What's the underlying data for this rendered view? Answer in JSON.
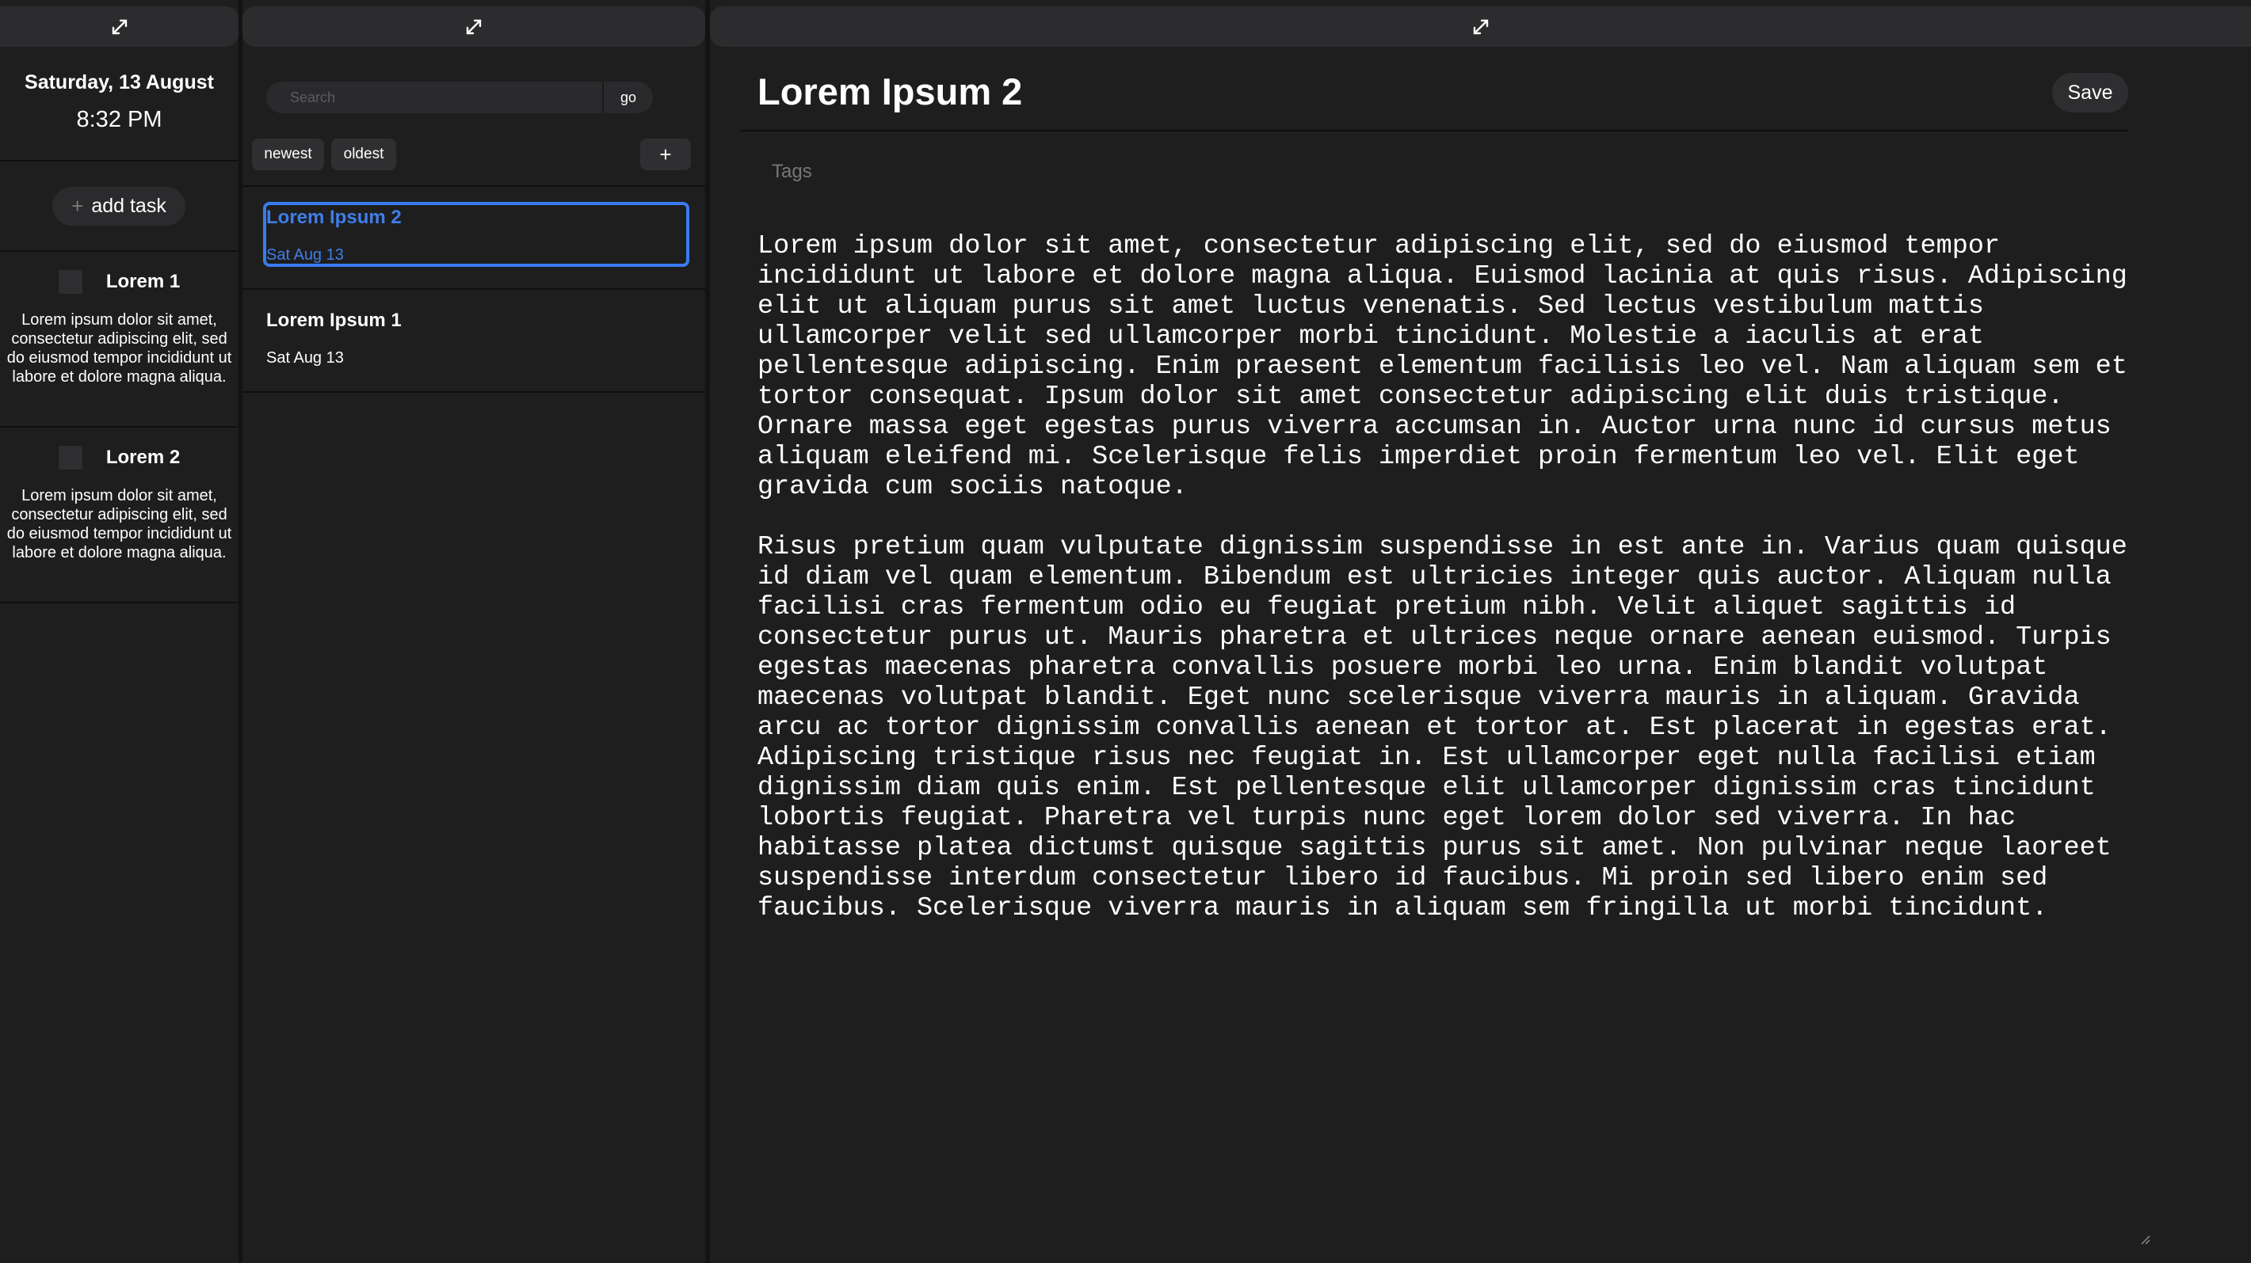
{
  "left_panel": {
    "expand_icon": "expand-diagonal-icon",
    "date": "Saturday, 13 August",
    "time": "8:32 PM",
    "add_task_label": "add task",
    "add_task_icon": "plus-icon",
    "tasks": [
      {
        "title": "Lorem 1",
        "checked": false,
        "description": "Lorem ipsum dolor sit amet, consectetur adipiscing elit, sed do eiusmod tempor incididunt ut labore et dolore magna aliqua."
      },
      {
        "title": "Lorem 2",
        "checked": false,
        "description": "Lorem ipsum dolor sit amet, consectetur adipiscing elit, sed do eiusmod tempor incididunt ut labore et dolore magna aliqua."
      }
    ]
  },
  "middle_panel": {
    "expand_icon": "expand-diagonal-icon",
    "search": {
      "placeholder": "Search",
      "value": "",
      "go_label": "go"
    },
    "sort": {
      "newest_label": "newest",
      "oldest_label": "oldest"
    },
    "new_note_label": "+",
    "notes": [
      {
        "title": "Lorem Ipsum 2",
        "date": "Sat Aug 13",
        "selected": true
      },
      {
        "title": "Lorem Ipsum 1",
        "date": "Sat Aug 13",
        "selected": false
      }
    ]
  },
  "editor": {
    "expand_icon": "expand-diagonal-icon",
    "title": "Lorem Ipsum 2",
    "save_label": "Save",
    "tags_placeholder": "Tags",
    "tags_value": "",
    "paragraphs": [
      "Lorem ipsum dolor sit amet, consectetur adipiscing elit, sed do eiusmod tempor incididunt ut labore et dolore magna aliqua. Euismod lacinia at quis risus. Adipiscing elit ut aliquam purus sit amet luctus venenatis. Sed lectus vestibulum mattis ullamcorper velit sed ullamcorper morbi tincidunt. Molestie a iaculis at erat pellentesque adipiscing. Enim praesent elementum facilisis leo vel. Nam aliquam sem et tortor consequat. Ipsum dolor sit amet consectetur adipiscing elit duis tristique. Ornare massa eget egestas purus viverra accumsan in. Auctor urna nunc id cursus metus aliquam eleifend mi. Scelerisque felis imperdiet proin fermentum leo vel. Elit eget gravida cum sociis natoque.",
      "Risus pretium quam vulputate dignissim suspendisse in est ante in. Varius quam quisque id diam vel quam elementum. Bibendum est ultricies integer quis auctor. Aliquam nulla facilisi cras fermentum odio eu feugiat pretium nibh. Velit aliquet sagittis id consectetur purus ut. Mauris pharetra et ultrices neque ornare aenean euismod. Turpis egestas maecenas pharetra convallis posuere morbi leo urna. Enim blandit volutpat maecenas volutpat blandit. Eget nunc scelerisque viverra mauris in aliquam. Gravida arcu ac tortor dignissim convallis aenean et tortor at. Est placerat in egestas erat. Adipiscing tristique risus nec feugiat in. Est ullamcorper eget nulla facilisi etiam dignissim diam quis enim. Est pellentesque elit ullamcorper dignissim cras tincidunt lobortis feugiat. Pharetra vel turpis nunc eget lorem dolor sed viverra. In hac habitasse platea dictumst quisque sagittis purus sit amet. Non pulvinar neque laoreet suspendisse interdum consectetur libero id faucibus. Mi proin sed libero enim sed faucibus. Scelerisque viverra mauris in aliquam sem fringilla ut morbi tincidunt."
    ]
  },
  "colors": {
    "background": "#1e1e1f",
    "surface": "#2c2c2e",
    "accent": "#3a7bf2",
    "text": "#ffffff"
  }
}
